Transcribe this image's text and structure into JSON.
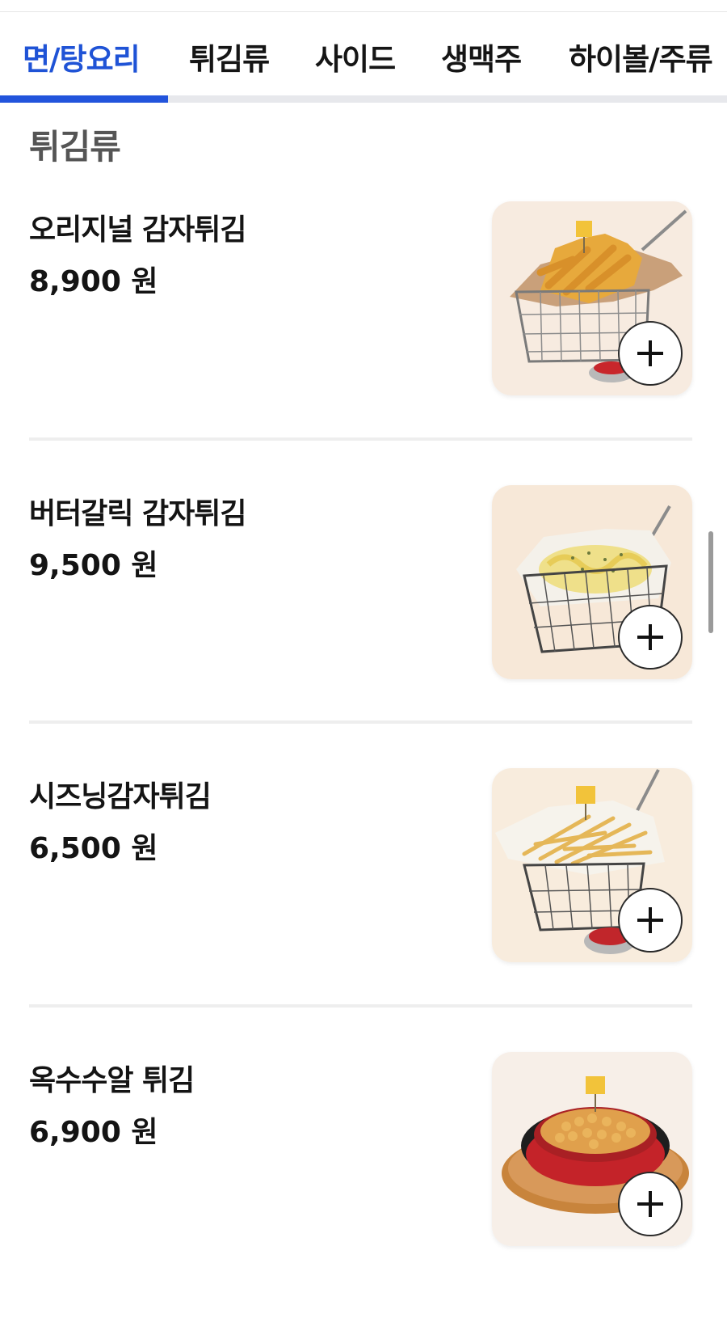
{
  "tabs": [
    {
      "label": "면/탕요리",
      "active": true
    },
    {
      "label": "튀김류",
      "active": false
    },
    {
      "label": "사이드",
      "active": false
    },
    {
      "label": "생맥주",
      "active": false
    },
    {
      "label": "하이볼/주류",
      "active": false
    }
  ],
  "section": {
    "title": "튀김류"
  },
  "items": [
    {
      "name": "오리지널 감자튀김",
      "price": "8,900 원",
      "image": "fries-basket-wedges"
    },
    {
      "name": "버터갈릭 감자튀김",
      "price": "9,500 원",
      "image": "fries-basket-garlic-sauce"
    },
    {
      "name": "시즈닝감자튀김",
      "price": "6,500 원",
      "image": "fries-basket-seasoned"
    },
    {
      "name": "옥수수알 튀김",
      "price": "6,900 원",
      "image": "fried-corn-skillet"
    }
  ],
  "icons": {
    "add": "plus-icon"
  },
  "colors": {
    "accent": "#2254dc",
    "active_tab_text": "#1f53d6",
    "tab_track": "#e7e8ec",
    "text": "#141414",
    "section_title": "#555555",
    "divider": "#eeeeee"
  }
}
